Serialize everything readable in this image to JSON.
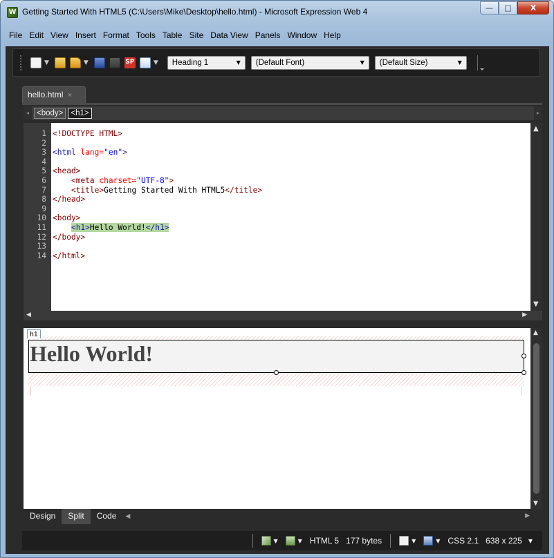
{
  "window": {
    "title": "Getting Started With HTML5 (C:\\Users\\Mike\\Desktop\\hello.html) - Microsoft Expression Web 4",
    "app_icon_letter": "W",
    "minimize": "—",
    "maximize": "□",
    "close": "X"
  },
  "menu": [
    "File",
    "Edit",
    "View",
    "Insert",
    "Format",
    "Tools",
    "Table",
    "Site",
    "Data View",
    "Panels",
    "Window",
    "Help"
  ],
  "toolbar": {
    "style_select": "Heading 1",
    "font_select": "(Default Font)",
    "size_select": "(Default Size)",
    "sp_icon_text": "SP"
  },
  "document_tab": {
    "label": "hello.html",
    "close": "×"
  },
  "breadcrumb": [
    "<body>",
    "<h1>"
  ],
  "code": {
    "line_numbers": [
      "1",
      "2",
      "3",
      "4",
      "5",
      "6",
      "7",
      "8",
      "9",
      "10",
      "11",
      "12",
      "13",
      "14"
    ],
    "lines": {
      "l1": "<!DOCTYPE HTML>",
      "l3_open": "<html ",
      "l3_attr": "lang=",
      "l3_val": "\"en\"",
      "l3_close": ">",
      "l5": "<head>",
      "l6_indent": "    ",
      "l6_open": "<meta ",
      "l6_attr": "charset=",
      "l6_val": "\"UTF-8\"",
      "l6_close": ">",
      "l7_indent": "    ",
      "l7_open": "<title>",
      "l7_text": "Getting Started With HTML5",
      "l7_close": "</title>",
      "l8": "</head>",
      "l10": "<body>",
      "l11_indent": "    ",
      "l11_open": "<h1>",
      "l11_text": "Hello World!",
      "l11_close": "</h1>",
      "l12": "</body>",
      "l14": "</html>"
    }
  },
  "design": {
    "h1_label": "h1",
    "heading_text": "Hello World!"
  },
  "view_tabs": [
    "Design",
    "Split",
    "Code"
  ],
  "status": {
    "doctype": "HTML 5",
    "size": "177 bytes",
    "css": "CSS 2.1",
    "dimensions": "638 x 225"
  },
  "colors": {
    "tag": "#800000",
    "attr": "#ff0000",
    "value": "#0000ff",
    "highlight": "#b4d8a0",
    "chrome_dark": "#2b2b2b"
  },
  "icons": [
    "new-page-icon",
    "open-icon",
    "save-icon",
    "sharepoint-icon",
    "preview-icon",
    "pen-icon",
    "document-icon",
    "link-icon",
    "layout-icon"
  ]
}
